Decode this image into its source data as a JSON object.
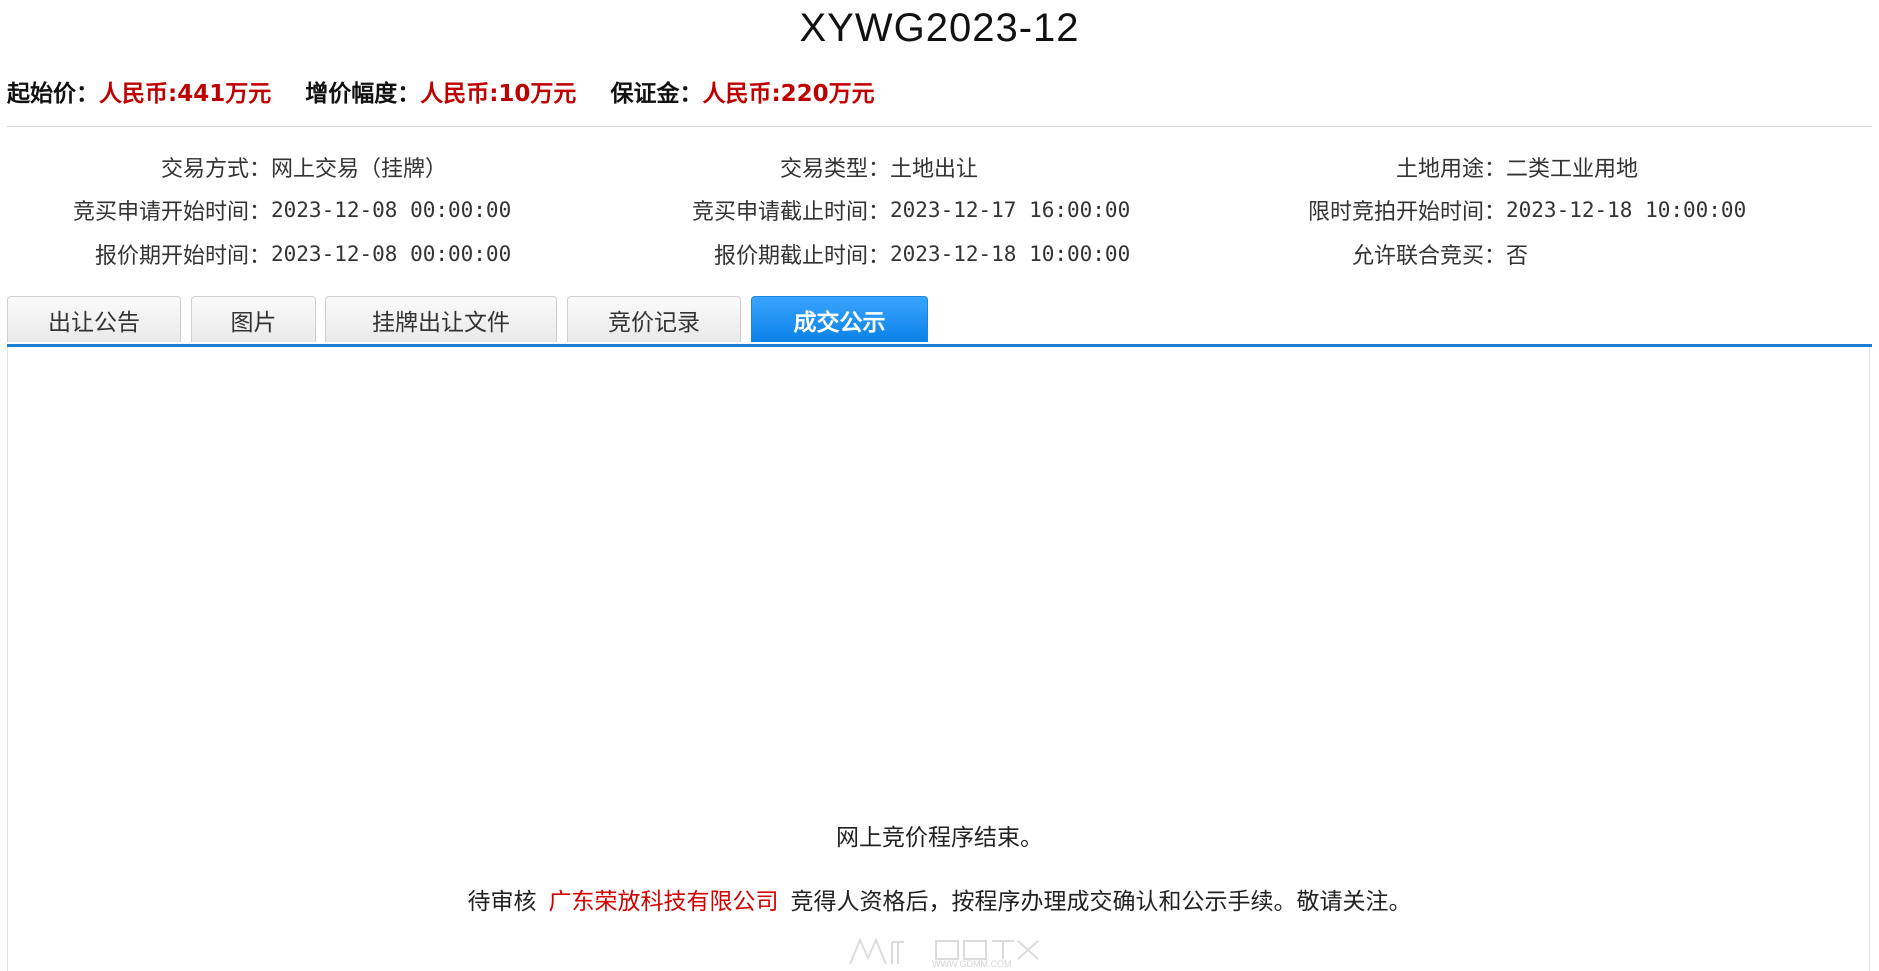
{
  "header": {
    "title": "XYWG2023-12"
  },
  "prices": [
    {
      "label": "起始价：",
      "value": "人民币:441万元"
    },
    {
      "label": "增价幅度：",
      "value": "人民币:10万元"
    },
    {
      "label": "保证金：",
      "value": "人民币:220万元"
    }
  ],
  "info": {
    "row1": [
      {
        "key": "交易方式：",
        "value": "网上交易（挂牌）"
      },
      {
        "key": "交易类型：",
        "value": "土地出让"
      },
      {
        "key": "土地用途：",
        "value": "二类工业用地"
      }
    ],
    "row2": [
      {
        "key": "竞买申请开始时间：",
        "value": "2023-12-08 00:00:00"
      },
      {
        "key": "竞买申请截止时间：",
        "value": "2023-12-17 16:00:00"
      },
      {
        "key": "限时竞拍开始时间：",
        "value": "2023-12-18 10:00:00"
      }
    ],
    "row3": [
      {
        "key": "报价期开始时间：",
        "value": "2023-12-08 00:00:00"
      },
      {
        "key": "报价期截止时间：",
        "value": "2023-12-18 10:00:00"
      },
      {
        "key": "允许联合竞买：",
        "value": "否"
      }
    ]
  },
  "tabs": [
    {
      "label": "出让公告",
      "active": false
    },
    {
      "label": "图片",
      "active": false
    },
    {
      "label": "挂牌出让文件",
      "active": false
    },
    {
      "label": "竞价记录",
      "active": false
    },
    {
      "label": "成交公示",
      "active": true
    }
  ],
  "notice": {
    "line1": "网上竞价程序结束。",
    "line2_prefix": "待审核",
    "company": "广东荣放科技有限公司",
    "line2_suffix": "竞得人资格后，按程序办理成交确认和公示手续。敬请关注。"
  },
  "watermark": {
    "text": "WWW.GDMM.COM"
  },
  "colors": {
    "price_value": "#c00000",
    "company": "#d40000",
    "tab_active": "#0a82e8",
    "tab_line": "#1b7fd6"
  }
}
